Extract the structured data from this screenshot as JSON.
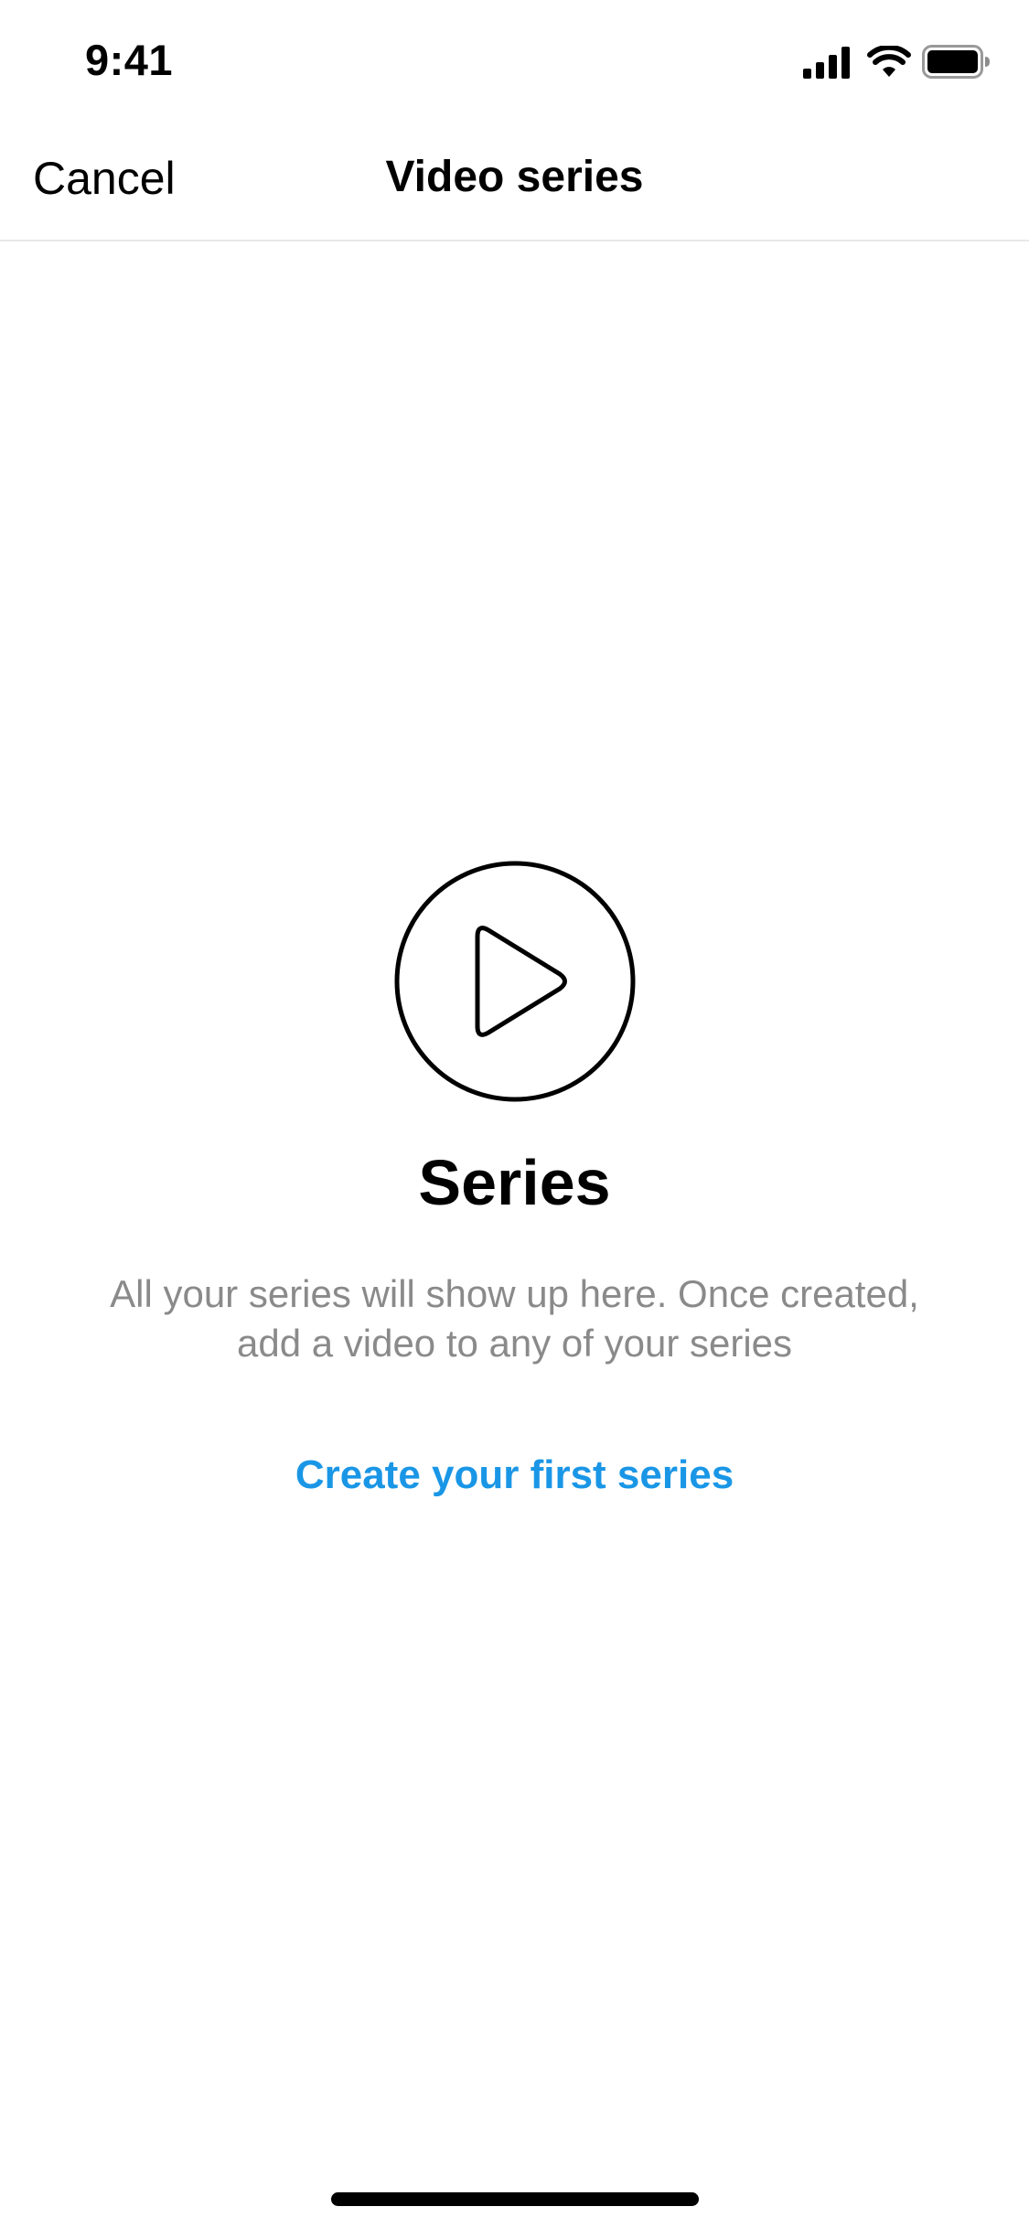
{
  "status_bar": {
    "time": "9:41",
    "icons": [
      "cellular-signal-icon",
      "wifi-icon",
      "battery-icon"
    ]
  },
  "nav": {
    "cancel_label": "Cancel",
    "title": "Video series"
  },
  "empty_state": {
    "icon": "play-circle-icon",
    "title": "Series",
    "description": "All your series will show up here. Once created, add a video to any of your series",
    "action_label": "Create your first series"
  },
  "colors": {
    "accent": "#1a96e6",
    "secondary_text": "#8a8a8a",
    "divider": "#e8e8e8"
  }
}
